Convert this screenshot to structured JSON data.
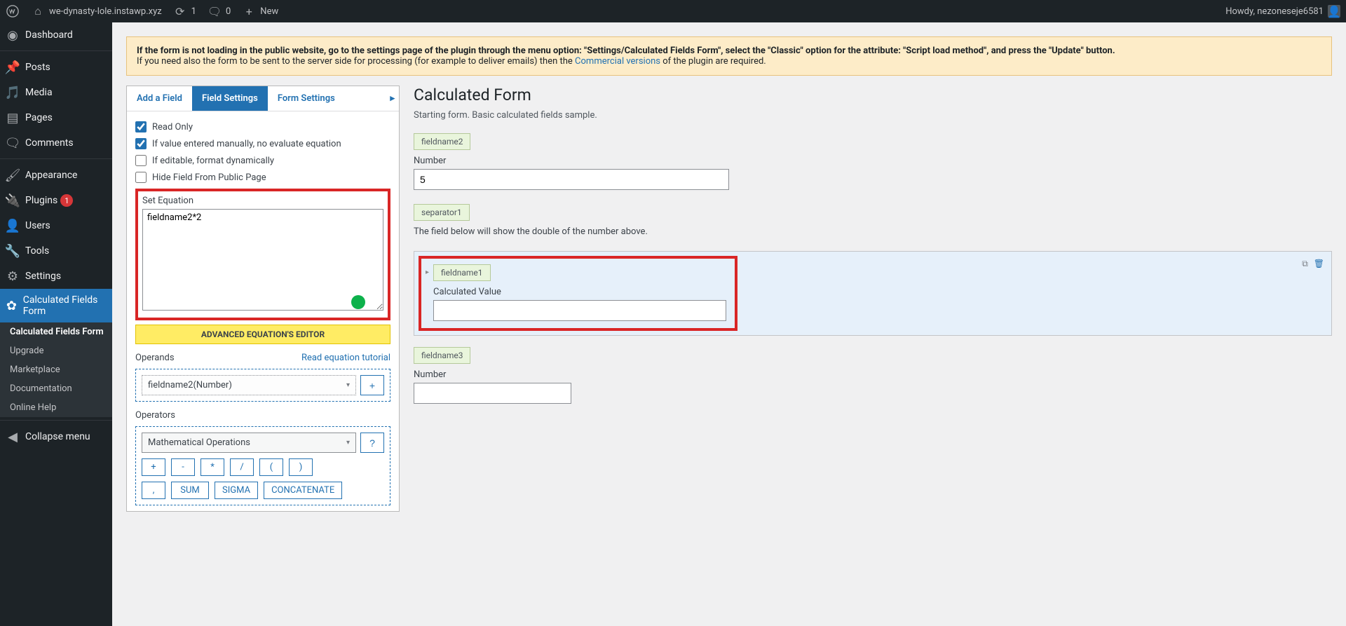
{
  "adminbar": {
    "site": "we-dynasty-lole.instawp.xyz",
    "updates": "1",
    "comments": "0",
    "new": "New",
    "howdy": "Howdy, nezoneseje6581"
  },
  "sidebar": {
    "dashboard": "Dashboard",
    "posts": "Posts",
    "media": "Media",
    "pages": "Pages",
    "comments": "Comments",
    "appearance": "Appearance",
    "plugins": "Plugins",
    "plugins_badge": "1",
    "users": "Users",
    "tools": "Tools",
    "settings": "Settings",
    "cff": "Calculated Fields Form",
    "submenu": {
      "cff": "Calculated Fields Form",
      "upgrade": "Upgrade",
      "marketplace": "Marketplace",
      "documentation": "Documentation",
      "onlinehelp": "Online Help"
    },
    "collapse": "Collapse menu"
  },
  "notice": {
    "t1": "If the form is not loading in the public website, go to the settings page of the plugin through the menu option: \"Settings/Calculated Fields Form\", select the \"Classic\" option for the attribute: \"Script load method\", and press the \"Update\" button.",
    "t2a": "If you need also the form to be sent to the server side for processing (for example to deliver emails) then the ",
    "t2link": "Commercial versions",
    "t2b": " of the plugin are required."
  },
  "tabs": {
    "add": "Add a Field",
    "fs": "Field Settings",
    "form": "Form Settings"
  },
  "panel": {
    "readonly": "Read Only",
    "noeval": "If value entered manually, no evaluate equation",
    "editfmt": "If editable, format dynamically",
    "hide": "Hide Field From Public Page",
    "seteq": "Set Equation",
    "equation": "fieldname2*2",
    "advbtn": "ADVANCED EQUATION'S EDITOR",
    "operands": "Operands",
    "readeq": "Read equation tutorial",
    "operand_sel": "fieldname2(Number)",
    "plus": "+",
    "operators": "Operators",
    "opsel": "Mathematical Operations",
    "q": "?",
    "ops1": [
      "+",
      "-",
      "*",
      "/",
      "(",
      ")"
    ],
    "ops2": [
      ",",
      "SUM",
      "SIGMA",
      "CONCATENATE"
    ]
  },
  "preview": {
    "title": "Calculated Form",
    "desc": "Starting form. Basic calculated fields sample.",
    "f1": {
      "tag": "fieldname2",
      "label": "Number",
      "value": "5"
    },
    "sep": {
      "tag": "separator1",
      "text": "The field below will show the double of the number above."
    },
    "f2": {
      "tag": "fieldname1",
      "label": "Calculated Value"
    },
    "f3": {
      "tag": "fieldname3",
      "label": "Number"
    }
  }
}
